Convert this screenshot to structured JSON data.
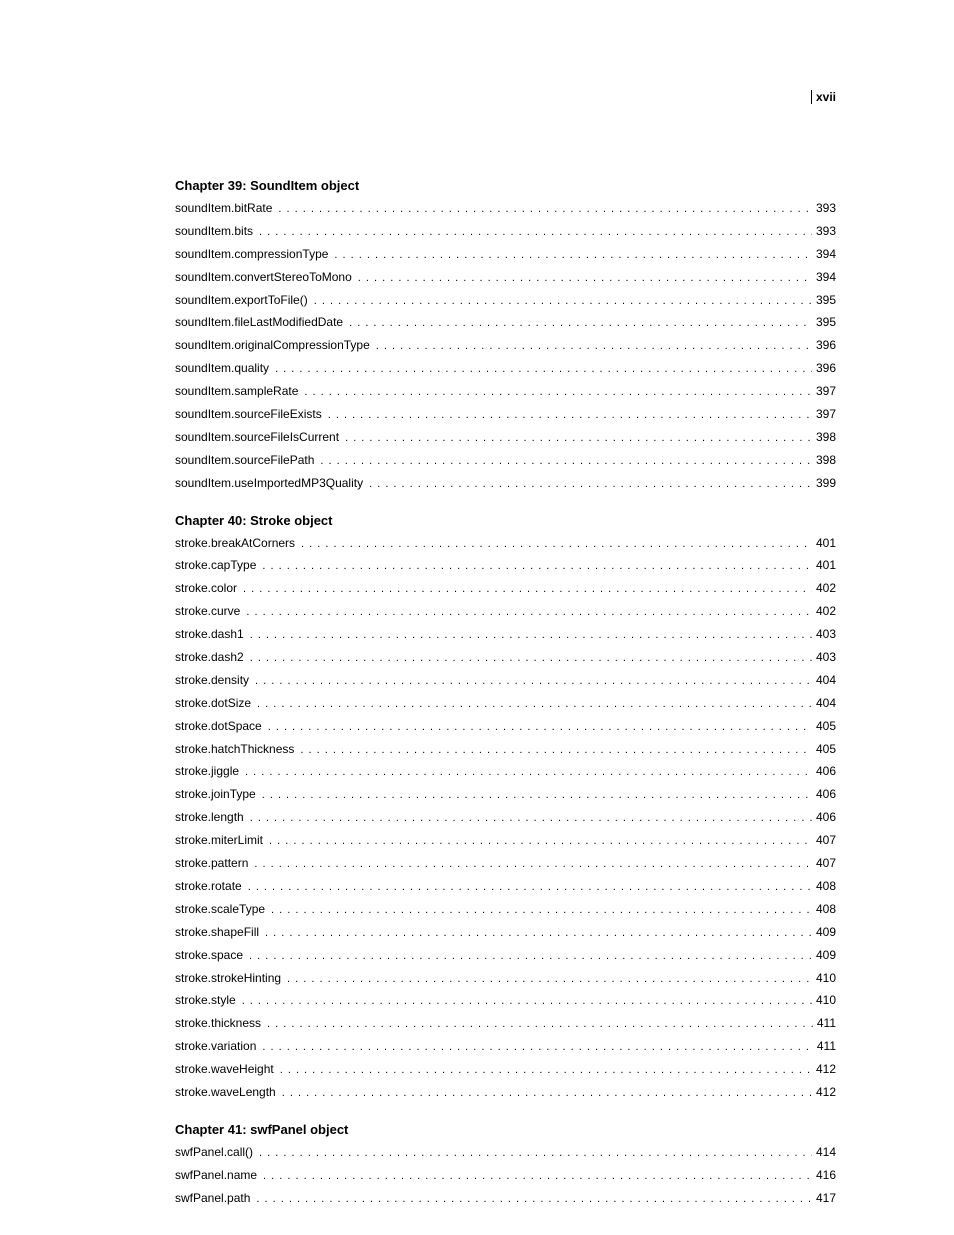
{
  "pageNumber": "xvii",
  "chapters": [
    {
      "title": "Chapter 39: SoundItem object",
      "entries": [
        {
          "label": "soundItem.bitRate",
          "page": "393"
        },
        {
          "label": "soundItem.bits",
          "page": "393"
        },
        {
          "label": "soundItem.compressionType",
          "page": "394"
        },
        {
          "label": "soundItem.convertStereoToMono",
          "page": "394"
        },
        {
          "label": "soundItem.exportToFile()",
          "page": "395"
        },
        {
          "label": "soundItem.fileLastModifiedDate",
          "page": "395"
        },
        {
          "label": "soundItem.originalCompressionType",
          "page": "396"
        },
        {
          "label": "soundItem.quality",
          "page": "396"
        },
        {
          "label": "soundItem.sampleRate",
          "page": "397"
        },
        {
          "label": "soundItem.sourceFileExists",
          "page": "397"
        },
        {
          "label": "soundItem.sourceFileIsCurrent",
          "page": "398"
        },
        {
          "label": "soundItem.sourceFilePath",
          "page": "398"
        },
        {
          "label": "soundItem.useImportedMP3Quality",
          "page": "399"
        }
      ]
    },
    {
      "title": "Chapter 40: Stroke object",
      "entries": [
        {
          "label": "stroke.breakAtCorners",
          "page": "401"
        },
        {
          "label": "stroke.capType",
          "page": "401"
        },
        {
          "label": "stroke.color",
          "page": "402"
        },
        {
          "label": "stroke.curve",
          "page": "402"
        },
        {
          "label": "stroke.dash1",
          "page": "403"
        },
        {
          "label": "stroke.dash2",
          "page": "403"
        },
        {
          "label": "stroke.density",
          "page": "404"
        },
        {
          "label": "stroke.dotSize",
          "page": "404"
        },
        {
          "label": "stroke.dotSpace",
          "page": "405"
        },
        {
          "label": "stroke.hatchThickness",
          "page": "405"
        },
        {
          "label": "stroke.jiggle",
          "page": "406"
        },
        {
          "label": "stroke.joinType",
          "page": "406"
        },
        {
          "label": "stroke.length",
          "page": "406"
        },
        {
          "label": "stroke.miterLimit",
          "page": "407"
        },
        {
          "label": "stroke.pattern",
          "page": "407"
        },
        {
          "label": "stroke.rotate",
          "page": "408"
        },
        {
          "label": "stroke.scaleType",
          "page": "408"
        },
        {
          "label": "stroke.shapeFill",
          "page": "409"
        },
        {
          "label": "stroke.space",
          "page": "409"
        },
        {
          "label": "stroke.strokeHinting",
          "page": "410"
        },
        {
          "label": "stroke.style",
          "page": "410"
        },
        {
          "label": "stroke.thickness",
          "page": "411"
        },
        {
          "label": "stroke.variation",
          "page": "411"
        },
        {
          "label": "stroke.waveHeight",
          "page": "412"
        },
        {
          "label": "stroke.waveLength",
          "page": "412"
        }
      ]
    },
    {
      "title": "Chapter 41: swfPanel object",
      "entries": [
        {
          "label": "swfPanel.call()",
          "page": "414"
        },
        {
          "label": "swfPanel.name",
          "page": "416"
        },
        {
          "label": "swfPanel.path",
          "page": "417"
        }
      ]
    }
  ]
}
